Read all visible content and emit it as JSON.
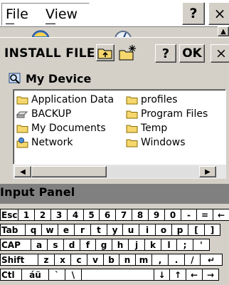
{
  "menu": {
    "file": "File",
    "view": "View",
    "help": "?",
    "close": "×"
  },
  "dialog": {
    "title": "INSTALL FILE",
    "help": "?",
    "ok": "OK",
    "close": "×",
    "location": "My Device",
    "items": [
      {
        "label": "Application Data",
        "icon": "folder-icon"
      },
      {
        "label": "profiles",
        "icon": "folder-icon"
      },
      {
        "label": "BACKUP",
        "icon": "drive-icon"
      },
      {
        "label": "Program Files",
        "icon": "folder-icon"
      },
      {
        "label": "My Documents",
        "icon": "folder-icon"
      },
      {
        "label": "Temp",
        "icon": "folder-icon"
      },
      {
        "label": "Network",
        "icon": "network-icon"
      },
      {
        "label": "Windows",
        "icon": "folder-icon"
      }
    ]
  },
  "input_panel": {
    "title": "Input Panel",
    "rows": [
      [
        "Esc",
        "1",
        "2",
        "3",
        "4",
        "5",
        "6",
        "7",
        "8",
        "9",
        "0",
        "-",
        "=",
        "←"
      ],
      [
        "Tab",
        "q",
        "w",
        "e",
        "r",
        "t",
        "y",
        "u",
        "i",
        "o",
        "p",
        "[",
        "]"
      ],
      [
        "CAP",
        "a",
        "s",
        "d",
        "f",
        "g",
        "h",
        "j",
        "k",
        "l",
        ";",
        "'"
      ],
      [
        "Shift",
        "z",
        "x",
        "c",
        "v",
        "b",
        "n",
        "m",
        ",",
        ".",
        "/",
        "↵"
      ],
      [
        "Ctl",
        "áü",
        "`",
        "\\",
        "",
        "↓",
        "↑",
        "←",
        "→"
      ]
    ]
  }
}
